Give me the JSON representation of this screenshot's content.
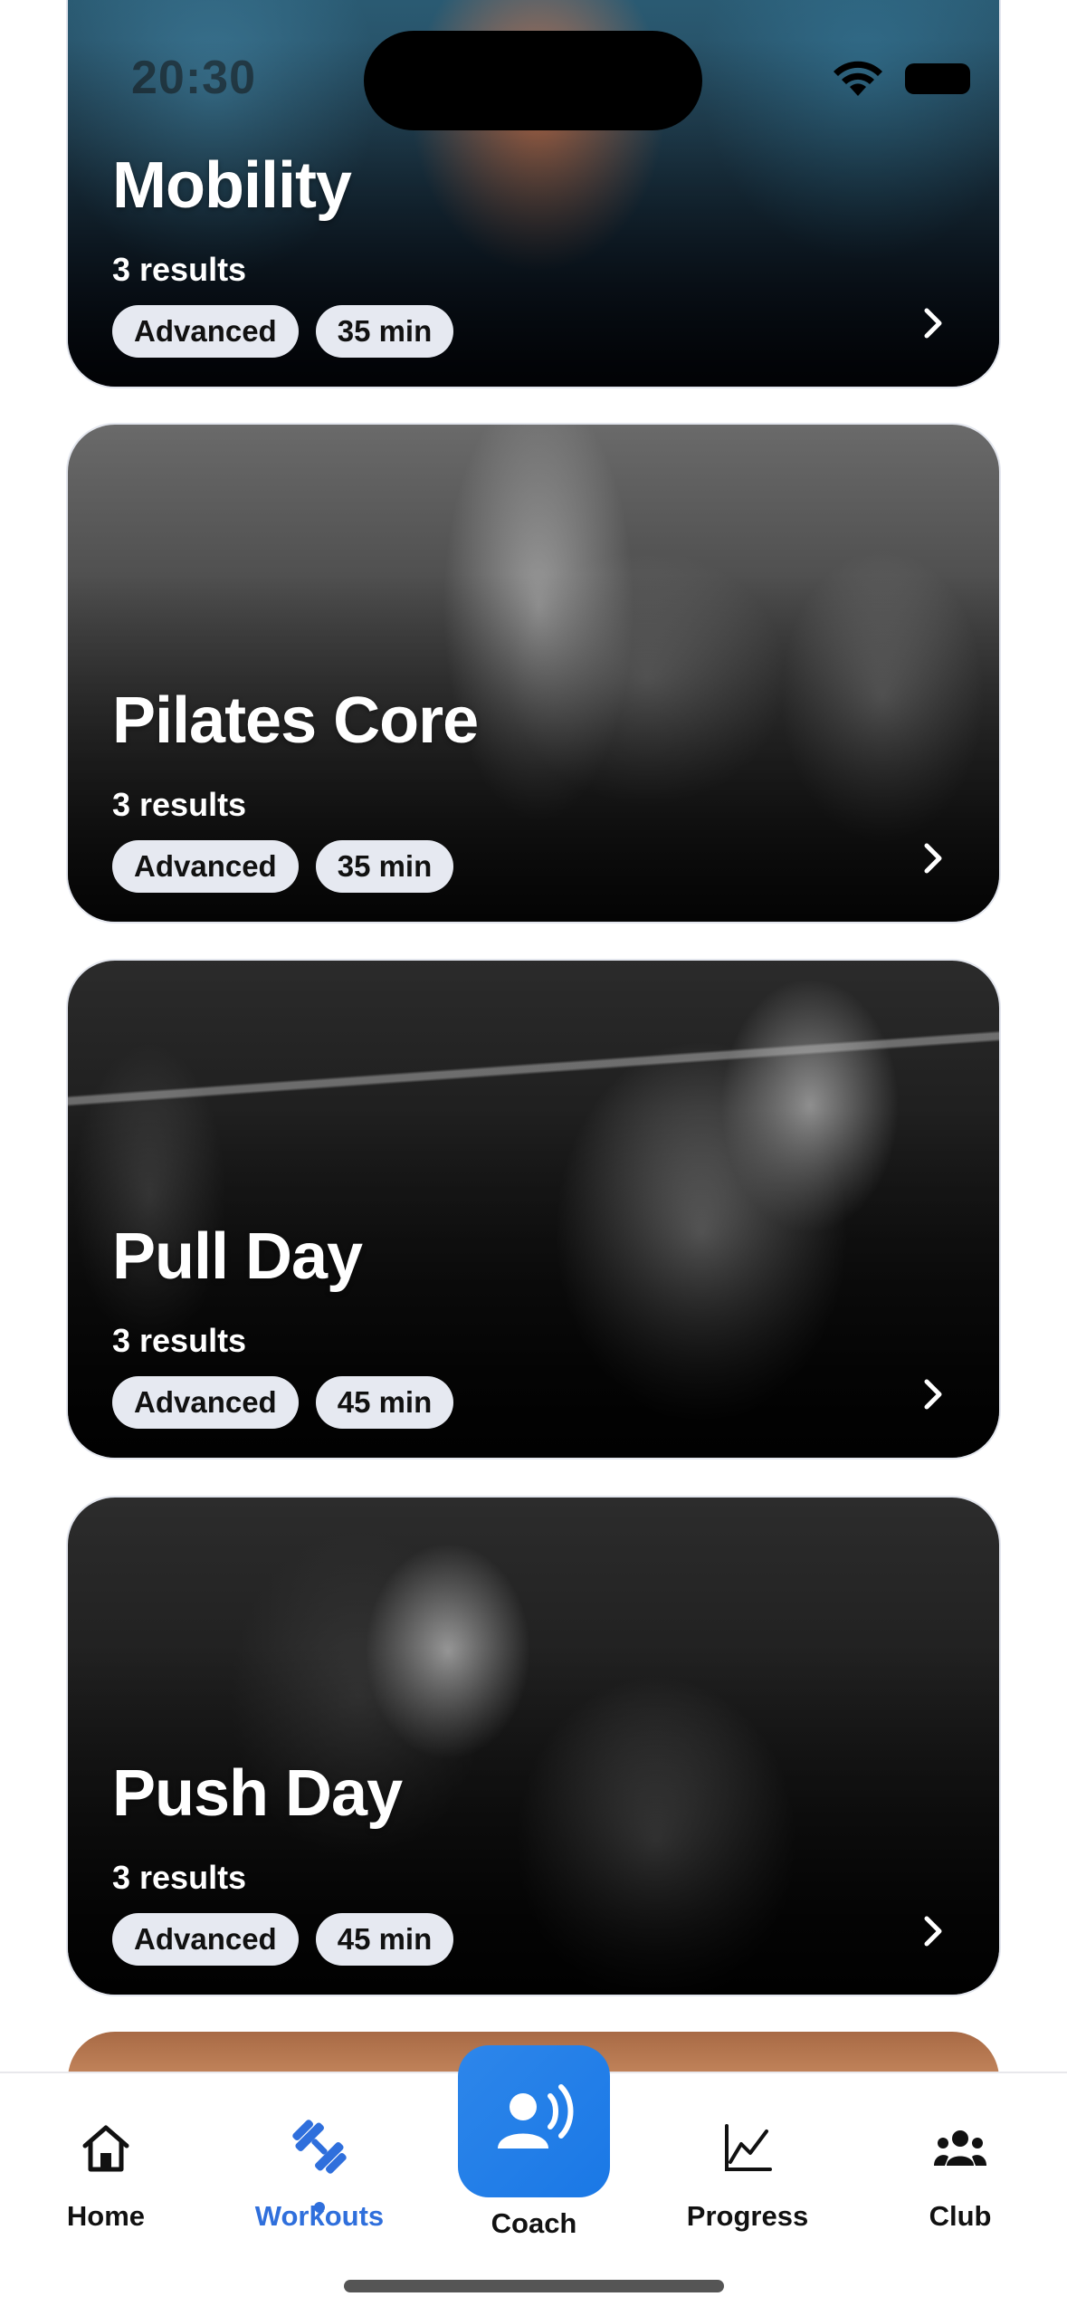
{
  "status_bar": {
    "time": "20:30"
  },
  "workouts": [
    {
      "title": "Mobility",
      "count": "3 results",
      "level": "Advanced",
      "duration": "35 min"
    },
    {
      "title": "Pilates Core",
      "count": "3 results",
      "level": "Advanced",
      "duration": "35 min"
    },
    {
      "title": "Pull Day",
      "count": "3 results",
      "level": "Advanced",
      "duration": "45 min"
    },
    {
      "title": "Push Day",
      "count": "3 results",
      "level": "Advanced",
      "duration": "45 min"
    }
  ],
  "tab_bar": {
    "items": [
      {
        "label": "Home",
        "icon": "home-icon"
      },
      {
        "label": "Workouts",
        "icon": "dumbbell-icon",
        "active": true
      },
      {
        "label": "Coach",
        "icon": "voice-coach-icon"
      },
      {
        "label": "Progress",
        "icon": "chart-line-icon"
      },
      {
        "label": "Club",
        "icon": "group-icon"
      }
    ]
  },
  "colors": {
    "accent": "#2f6fdc",
    "coach_button": "#1f7ee8",
    "chip_bg": "#e6e9f1"
  }
}
